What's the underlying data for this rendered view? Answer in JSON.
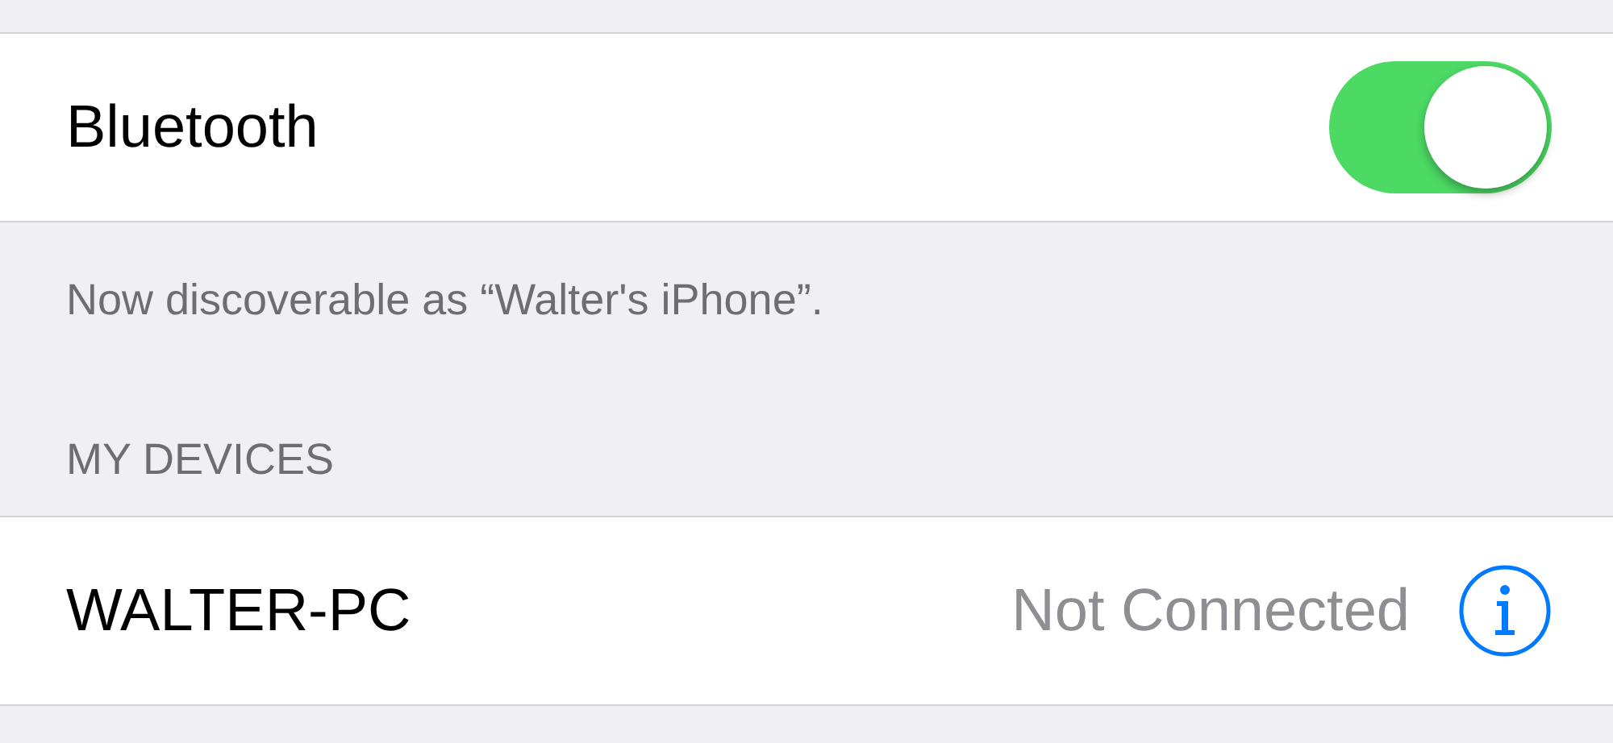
{
  "bluetooth": {
    "label": "Bluetooth",
    "on": true
  },
  "discoverable_note": "Now discoverable as “Walter's iPhone”.",
  "my_devices": {
    "header": "MY DEVICES",
    "devices": [
      {
        "name": "WALTER-PC",
        "status": "Not Connected"
      }
    ]
  }
}
